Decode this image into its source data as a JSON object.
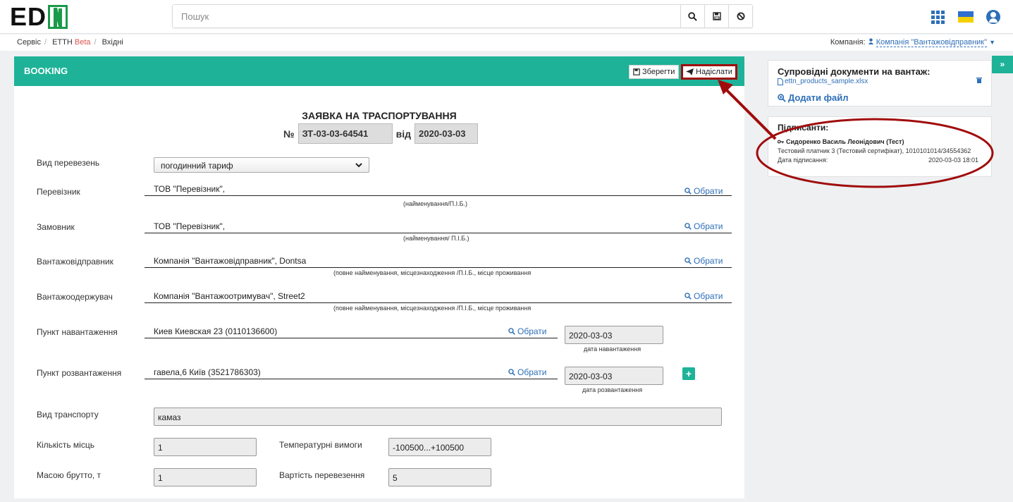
{
  "app": {
    "logo_prefix": "ED",
    "logo_suffix": "N"
  },
  "search": {
    "placeholder": "Пошук"
  },
  "breadcrumb": {
    "item1": "Сервіс",
    "item2": "ЕТТН",
    "beta": "Beta",
    "item3": "Вхідні"
  },
  "company": {
    "label": "Компанія:",
    "value": "Компанія \"Вантажовідправник\""
  },
  "panel": {
    "title": "BOOKING",
    "save_label": "Зберегти",
    "send_label": "Надіслати"
  },
  "document": {
    "heading": "ЗАЯВКА НА ТРАСПОРТУВАННЯ",
    "num_prefix": "№",
    "number": "ЗТ-03-03-64541",
    "date_prefix": "від",
    "date": "2020-03-03"
  },
  "form": {
    "transport_type_label": "Вид перевезень",
    "transport_type_value": "погодинний тариф",
    "carrier_label": "Перевізник",
    "carrier_value": "ТОВ \"Перевізник\",",
    "carrier_hint": "(найменування/П.І.Б.)",
    "customer_label": "Замовник",
    "customer_value": "ТОВ \"Перевізник\",",
    "customer_hint": "(найменування/ П.І.Б.)",
    "shipper_label": "Вантажовідправник",
    "shipper_value": "Компанія \"Вантажовідправник\", Dontsa",
    "shipper_hint": "(повне найменування, місцезнаходження /П.І.Б., місце проживання",
    "consignee_label": "Вантажоодержувач",
    "consignee_value": "Компанія \"Вантажоотримувач\", Street2",
    "consignee_hint": "(повне найменування, місцезнаходження /П.І.Б., місце проживання",
    "choose_label": "Обрати",
    "loading_label": "Пункт навантаження",
    "loading_value": "Киев Киевская 23 (0110136600)",
    "loading_date": "2020-03-03",
    "loading_date_hint": "дата навантаження",
    "unloading_label": "Пункт розвантаження",
    "unloading_value": "гавела,6 Київ (3521786303)",
    "unloading_date": "2020-03-03",
    "unloading_date_hint": "дата розвантаження",
    "vehicle_label": "Вид транспорту",
    "vehicle_value": "камаз",
    "places_label": "Кількість місць",
    "places_value": "1",
    "temp_label": "Температурні вимоги",
    "temp_value": "-100500...+100500",
    "gross_label": "Масою брутто, т",
    "gross_value": "1",
    "cost_label": "Вартість перевезення",
    "cost_value": "5"
  },
  "attachments": {
    "title": "Супровідні документи на вантаж:",
    "file": "ettn_products_sample.xlsx",
    "add_label": "Додати файл"
  },
  "signers": {
    "title": "Підписанти:",
    "name": "Сидоренко Василь Леонідович (Тест)",
    "cert": "Тестовий платник 3 (Тестовий сертифікат), 1010101014/34554362",
    "date_label": "Дата підписання:",
    "date_value": "2020-03-03 18:01"
  },
  "colors": {
    "accent": "#1eb398",
    "link": "#2e6fb8",
    "annotation": "#a00c0c"
  }
}
